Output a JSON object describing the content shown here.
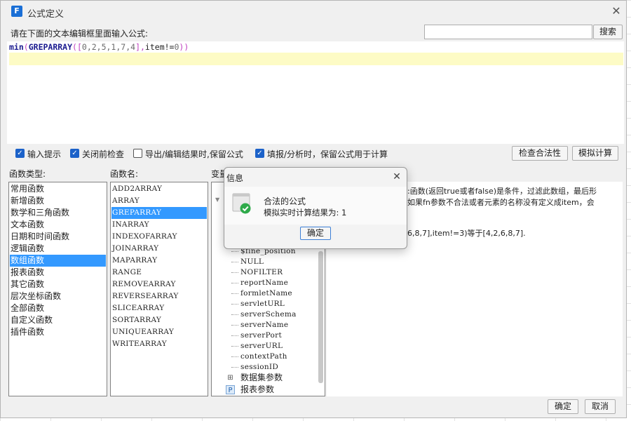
{
  "dialog": {
    "title": "公式定义",
    "close": "✕",
    "prompt": "请在下面的文本编辑框里面输入公式:",
    "search_button": "搜索",
    "formula_parts": [
      "min",
      "(",
      "GREPARRAY",
      "([",
      "0,2,5,1,7,4",
      "],",
      "item",
      "!=",
      "0",
      "))"
    ],
    "checks": [
      {
        "label": "输入提示",
        "checked": true
      },
      {
        "label": "关闭前检查",
        "checked": true
      },
      {
        "label": "导出/编辑结果时,保留公式",
        "checked": false
      },
      {
        "label": "填报/分析时，保留公式用于计算",
        "checked": true
      }
    ],
    "check_validity": "检查合法性",
    "simulate": "模拟计算",
    "category_label": "函数类型:",
    "function_label": "函数名:",
    "variable_label": "变量",
    "categories": [
      "常用函数",
      "新增函数",
      "数学和三角函数",
      "文本函数",
      "日期和时间函数",
      "逻辑函数",
      "数组函数",
      "报表函数",
      "其它函数",
      "层次坐标函数",
      "全部函数",
      "自定义函数",
      "插件函数"
    ],
    "selected_category": 6,
    "functions": [
      "ADD2ARRAY",
      "ARRAY",
      "GREPARRAY",
      "INARRAY",
      "INDEXOFARRAY",
      "JOINARRAY",
      "MAPARRAY",
      "RANGE",
      "REMOVEARRAY",
      "REVERSEARRAY",
      "SLICEARRAY",
      "SORTARRAY",
      "UNIQUEARRAY",
      "WRITEARRAY"
    ],
    "selected_function": 2,
    "variables": [
      "$fine_position",
      "NULL",
      "NOFILTER",
      "reportName",
      "formletName",
      "servletURL",
      "serverSchema",
      "serverName",
      "serverPort",
      "serverURL",
      "contextPath",
      "sessionID"
    ],
    "tree_nodes": [
      {
        "label": "数据集参数",
        "icon": "dataset-param-icon"
      },
      {
        "label": "报表参数",
        "icon": "report-param-icon",
        "glyph": "P"
      }
    ],
    "desc_lines": [
      ":函数(返回true或者false)是条件，过滤此数组，最后形",
      "如果fn参数不合法或者元素的名称没有定义成item，会",
      "6,8,7],item!=3)等于[4,2,6,8,7]."
    ],
    "ok": "确定",
    "cancel": "取消"
  },
  "message": {
    "title": "信息",
    "close": "✕",
    "line1": "合法的公式",
    "line2": "模拟实时计算结果为: 1",
    "ok": "确定",
    "success_color": "#2eaa4a"
  }
}
